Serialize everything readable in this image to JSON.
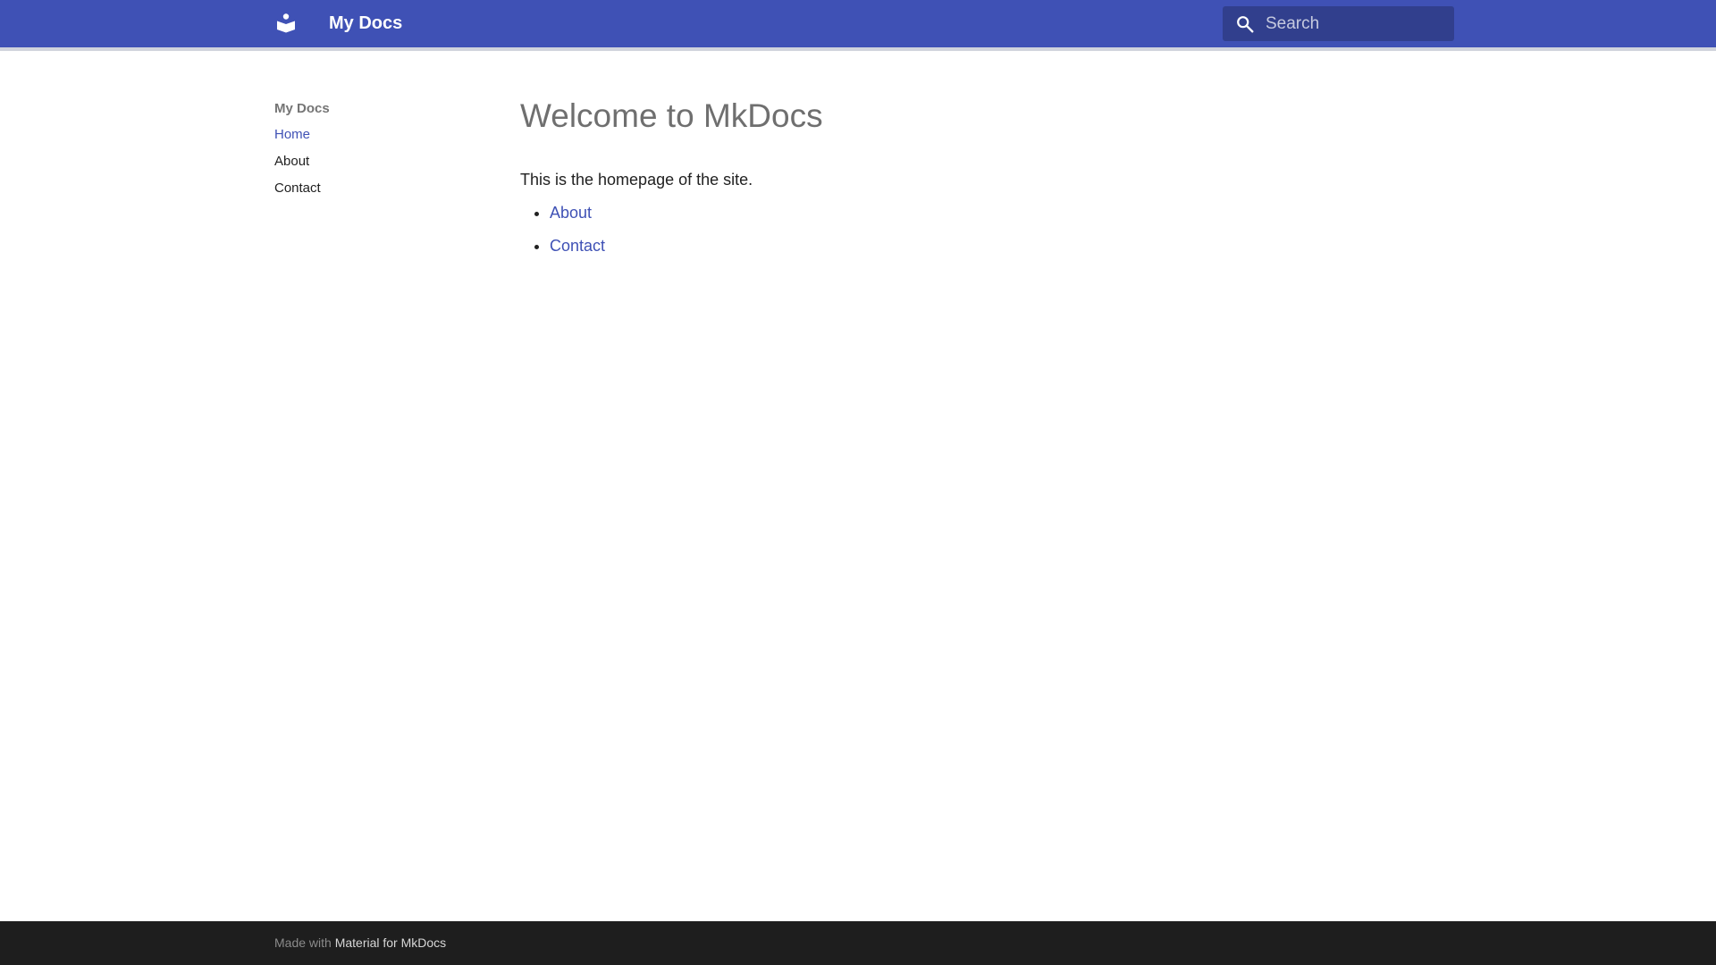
{
  "header": {
    "logo_icon": "book-reader-icon",
    "site_title": "My Docs",
    "search": {
      "icon": "search-icon",
      "placeholder": "Search"
    },
    "colors": {
      "primary": "#3f51b5"
    }
  },
  "sidebar": {
    "title": "My Docs",
    "items": [
      {
        "label": "Home",
        "active": true
      },
      {
        "label": "About",
        "active": false
      },
      {
        "label": "Contact",
        "active": false
      }
    ]
  },
  "main": {
    "title": "Welcome to MkDocs",
    "intro": "This is the homepage of the site.",
    "links": [
      {
        "label": "About"
      },
      {
        "label": "Contact"
      }
    ]
  },
  "footer": {
    "prefix": "Made with",
    "link_label": "Material for MkDocs"
  }
}
